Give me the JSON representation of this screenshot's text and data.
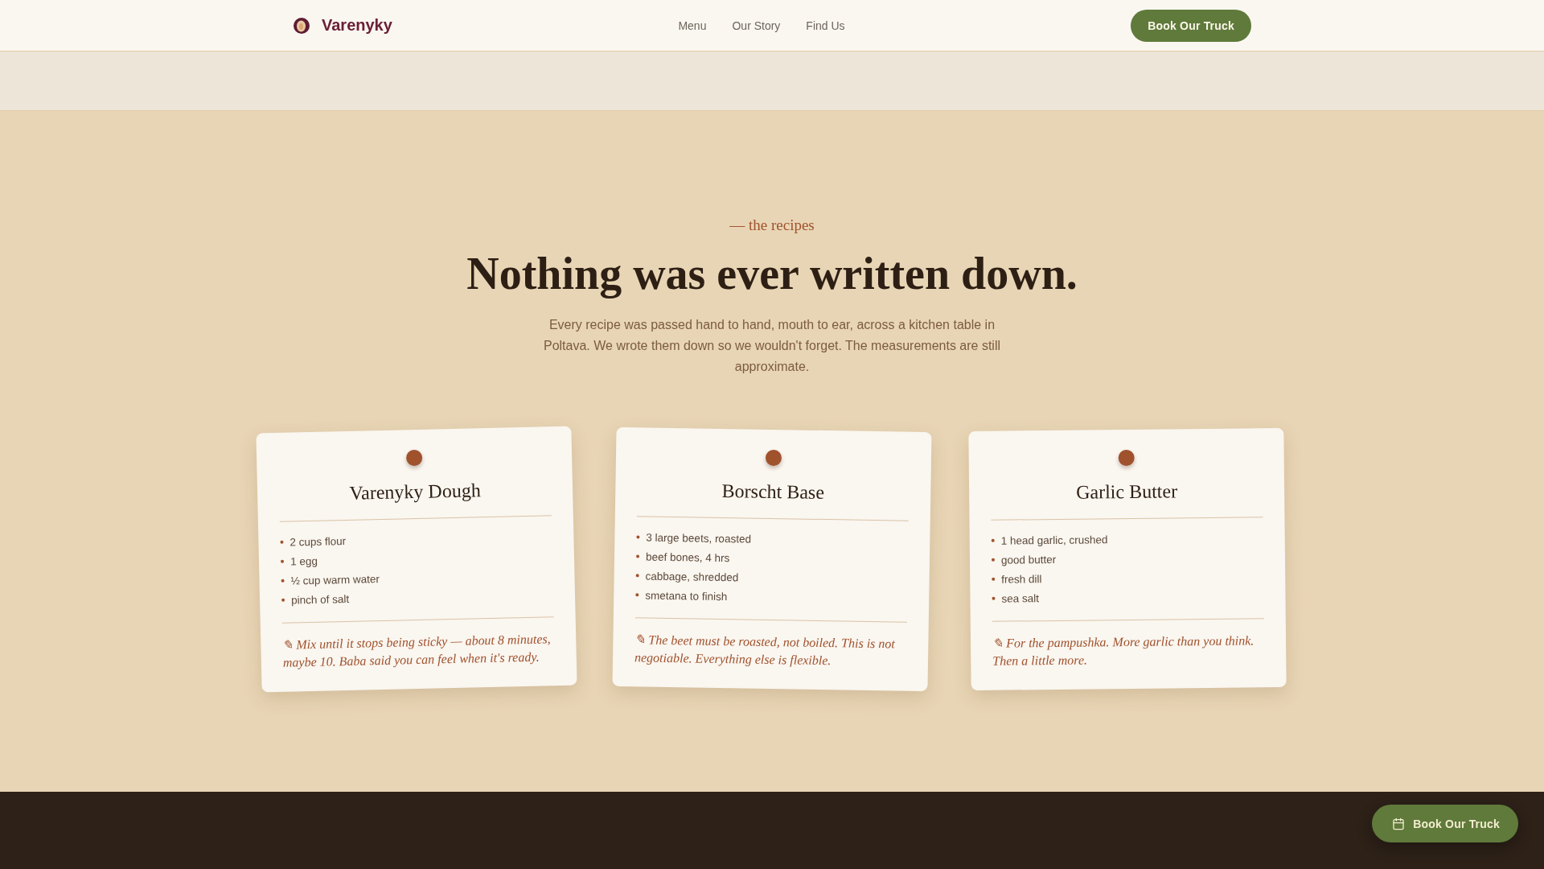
{
  "header": {
    "brand": "Varenyky",
    "nav": [
      {
        "label": "Menu"
      },
      {
        "label": "Our Story"
      },
      {
        "label": "Find Us"
      }
    ],
    "cta": "Book Our Truck"
  },
  "recipes": {
    "eyebrow": "— the recipes",
    "title": "Nothing was ever written down.",
    "intro": "Every recipe was passed hand to hand, mouth to ear, across a kitchen table in Poltava. We wrote them down so we wouldn't forget. The measurements are still approximate.",
    "cards": [
      {
        "title": "Varenyky Dough",
        "ingredients": [
          "2 cups flour",
          "1 egg",
          "½ cup warm water",
          "pinch of salt"
        ],
        "note": "✎ Mix until it stops being sticky — about 8 minutes, maybe 10. Baba said you can feel when it's ready."
      },
      {
        "title": "Borscht Base",
        "ingredients": [
          "3 large beets, roasted",
          "beef bones, 4 hrs",
          "cabbage, shredded",
          "smetana to finish"
        ],
        "note": "✎ The beet must be roasted, not boiled. This is not negotiable. Everything else is flexible."
      },
      {
        "title": "Garlic Butter",
        "ingredients": [
          "1 head garlic, crushed",
          "good butter",
          "fresh dill",
          "sea salt"
        ],
        "note": "✎ For the pampushka. More garlic than you think. Then a little more."
      }
    ]
  },
  "floating_button": {
    "label": "Book Our Truck"
  }
}
